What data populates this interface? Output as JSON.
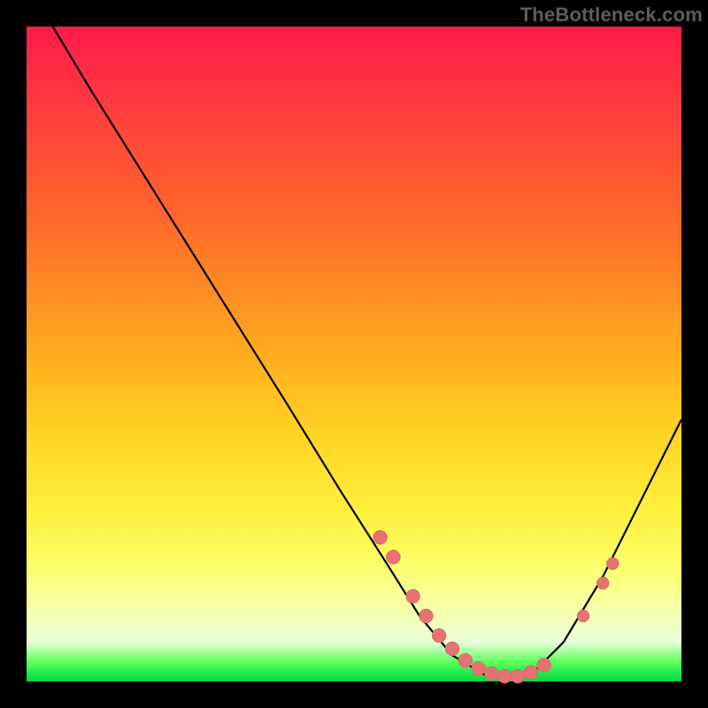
{
  "watermark": "TheBottleneck.com",
  "colors": {
    "curve_stroke": "#000000",
    "marker_fill": "#e57373",
    "marker_stroke": "#d65a5a"
  },
  "chart_data": {
    "type": "line",
    "title": "",
    "xlabel": "",
    "ylabel": "",
    "xlim": [
      0,
      100
    ],
    "ylim": [
      0,
      100
    ],
    "curve": [
      {
        "x": 4,
        "y": 100
      },
      {
        "x": 10,
        "y": 90
      },
      {
        "x": 20,
        "y": 74
      },
      {
        "x": 30,
        "y": 58
      },
      {
        "x": 40,
        "y": 42
      },
      {
        "x": 48,
        "y": 29
      },
      {
        "x": 55,
        "y": 18
      },
      {
        "x": 60,
        "y": 10
      },
      {
        "x": 65,
        "y": 4
      },
      {
        "x": 70,
        "y": 1
      },
      {
        "x": 74,
        "y": 0.5
      },
      {
        "x": 78,
        "y": 2
      },
      {
        "x": 82,
        "y": 6
      },
      {
        "x": 88,
        "y": 16
      },
      {
        "x": 93,
        "y": 26
      },
      {
        "x": 100,
        "y": 40
      }
    ],
    "markers_left": [
      {
        "x": 54,
        "y": 22
      },
      {
        "x": 56,
        "y": 19
      },
      {
        "x": 59,
        "y": 13
      },
      {
        "x": 61,
        "y": 10
      },
      {
        "x": 63,
        "y": 7
      },
      {
        "x": 65,
        "y": 5
      },
      {
        "x": 67,
        "y": 3.2
      },
      {
        "x": 69,
        "y": 2
      },
      {
        "x": 71,
        "y": 1.2
      },
      {
        "x": 73,
        "y": 0.8
      },
      {
        "x": 75,
        "y": 0.8
      },
      {
        "x": 77,
        "y": 1.4
      },
      {
        "x": 79,
        "y": 2.5
      }
    ],
    "markers_right": [
      {
        "x": 85,
        "y": 10
      },
      {
        "x": 88,
        "y": 15
      },
      {
        "x": 89.5,
        "y": 18
      }
    ]
  }
}
